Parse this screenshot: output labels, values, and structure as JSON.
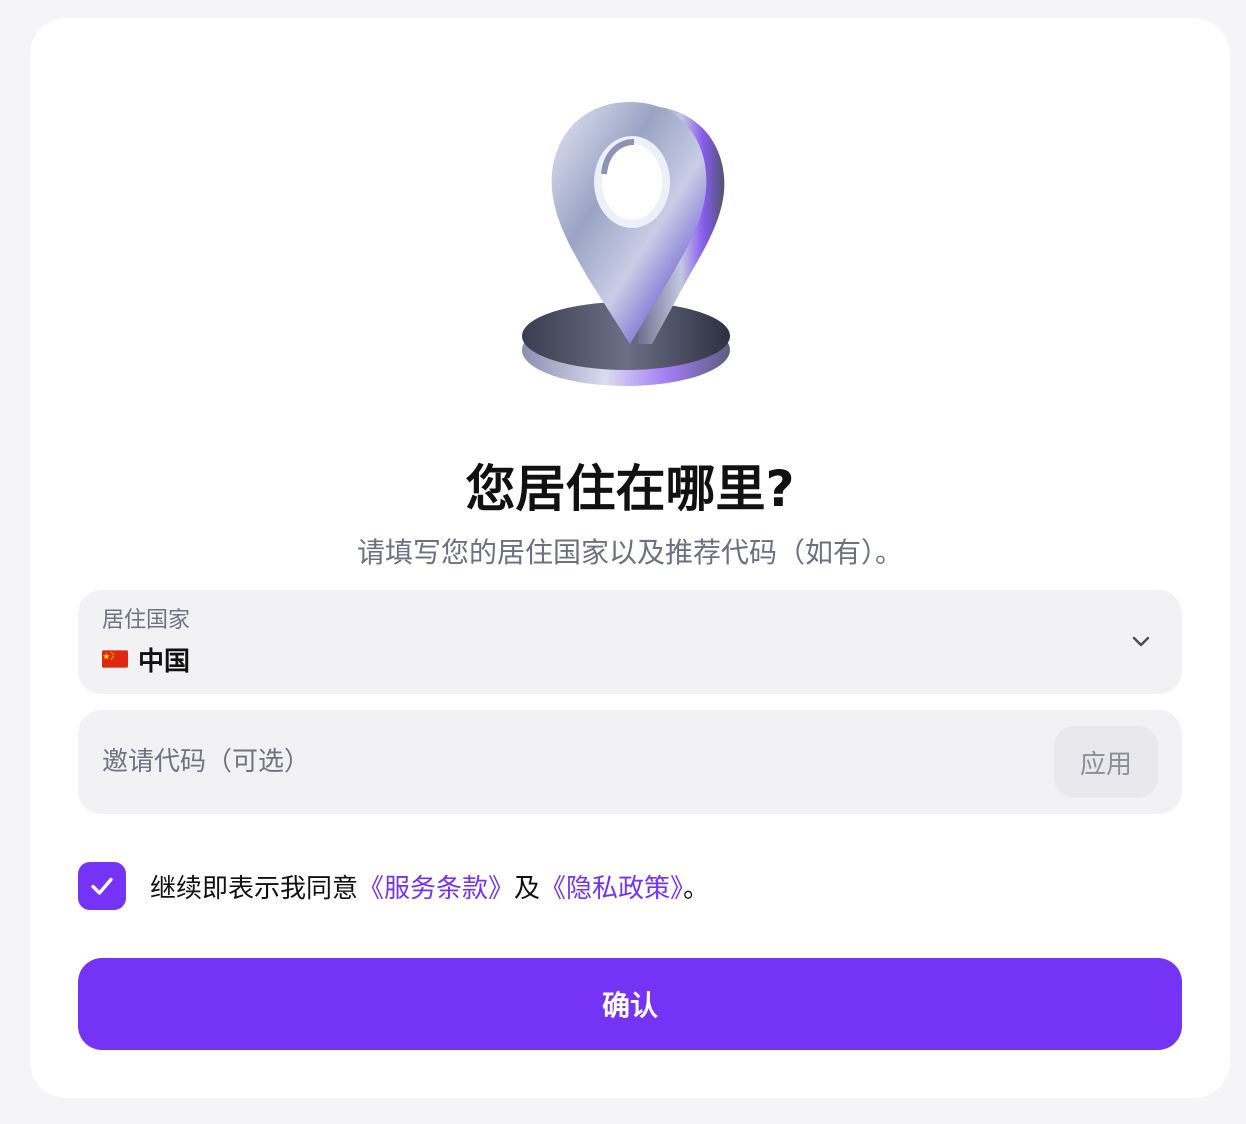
{
  "header": {
    "title": "您居住在哪里?",
    "subtitle": "请填写您的居住国家以及推荐代码（如有）。"
  },
  "country_field": {
    "label": "居住国家",
    "value": "中国",
    "flag_icon": "china-flag-icon"
  },
  "invite_field": {
    "placeholder": "邀请代码（可选）",
    "value": "",
    "apply_label": "应用"
  },
  "agreement": {
    "checked": true,
    "prefix": "继续即表示我同意",
    "terms_link": "《服务条款》",
    "and": "及",
    "privacy_link": "《隐私政策》",
    "suffix": "。"
  },
  "confirm_label": "确认",
  "colors": {
    "accent": "#7433f5",
    "field_bg": "#f2f2f5",
    "page_bg": "#f5f5f8"
  }
}
